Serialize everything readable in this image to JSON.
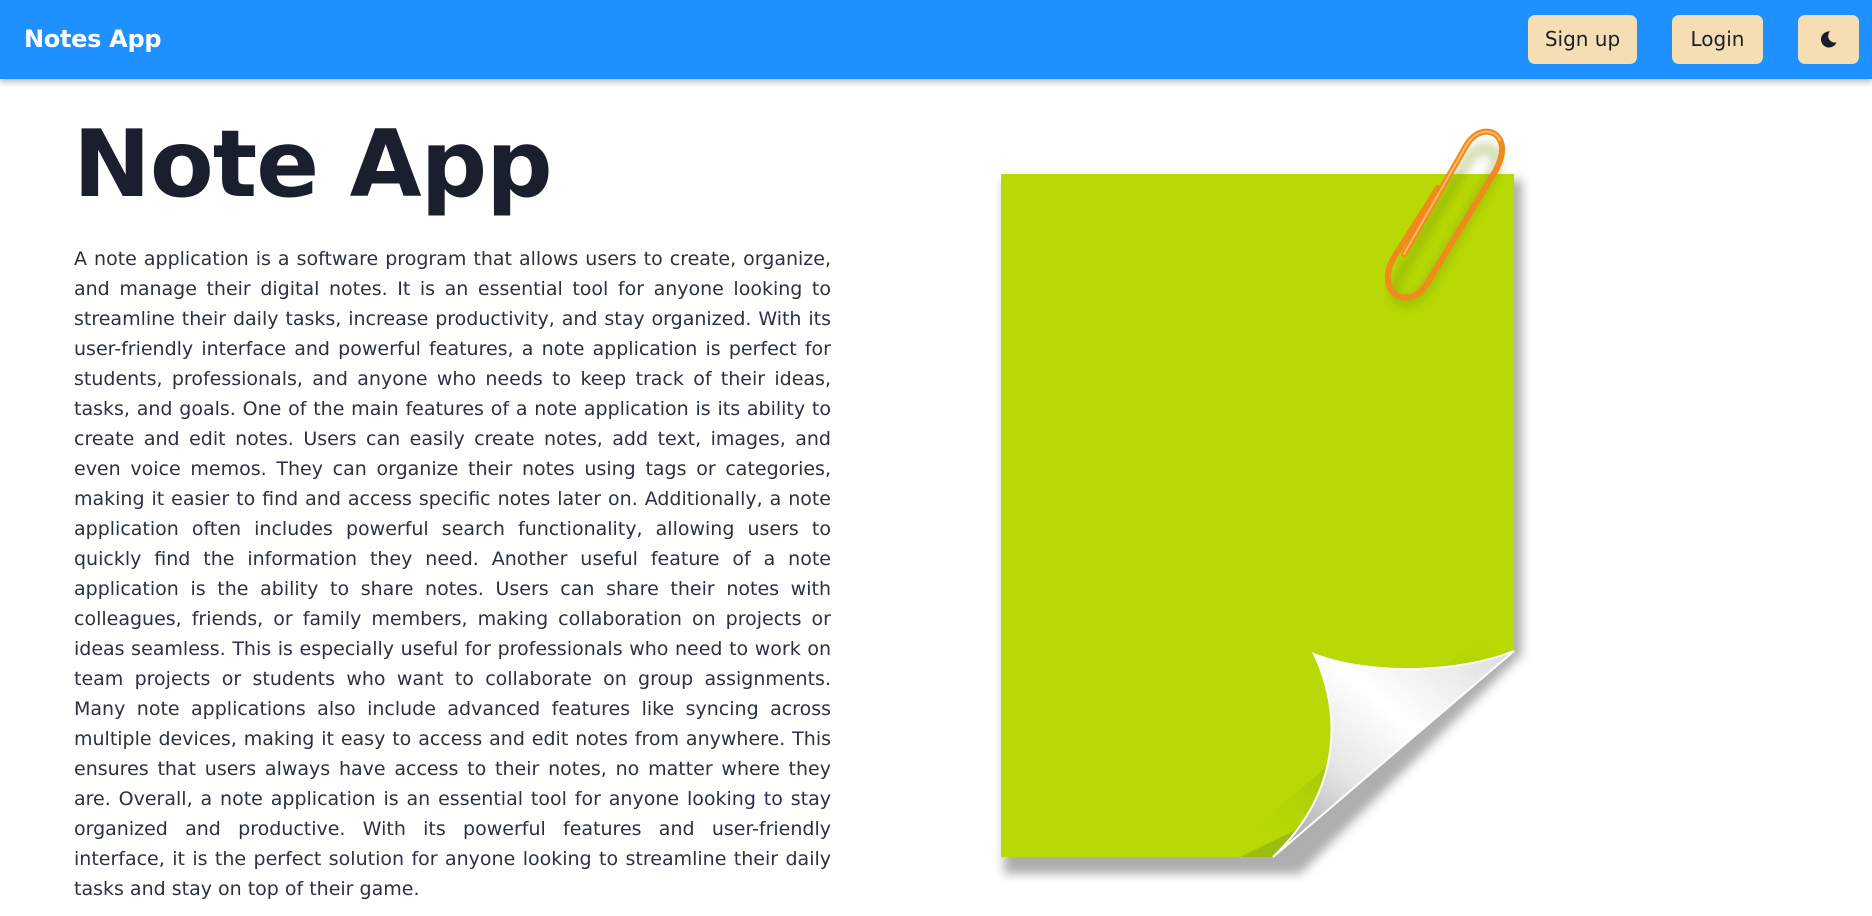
{
  "navbar": {
    "brand": "Notes App",
    "signup_label": "Sign up",
    "login_label": "Login",
    "theme_toggle_icon": "moon-icon",
    "background_color": "#1e90ff",
    "button_color": "#f5deb3"
  },
  "hero": {
    "title": "Note App",
    "description": "A note application is a software program that allows users to create, organize, and manage their digital notes. It is an essential tool for anyone looking to streamline their daily tasks, increase productivity, and stay organized. With its user-friendly interface and powerful features, a note application is perfect for students, professionals, and anyone who needs to keep track of their ideas, tasks, and goals. One of the main features of a note application is its ability to create and edit notes. Users can easily create notes, add text, images, and even voice memos. They can organize their notes using tags or categories, making it easier to find and access specific notes later on. Additionally, a note application often includes powerful search functionality, allowing users to quickly find the information they need. Another useful feature of a note application is the ability to share notes. Users can share their notes with colleagues, friends, or family members, making collaboration on projects or ideas seamless. This is especially useful for professionals who need to work on team projects or students who want to collaborate on group assignments. Many note applications also include advanced features like syncing across multiple devices, making it easy to access and edit notes from anywhere. This ensures that users always have access to their notes, no matter where they are. Overall, a note application is an essential tool for anyone looking to stay organized and productive. With its powerful features and user-friendly interface, it is the perfect solution for anyone looking to streamline their daily tasks and stay on top of their game."
  },
  "illustration": {
    "icon": "sticky-note-paperclip-illustration",
    "note_color": "#b8d905",
    "clip_color": "#f08a1c"
  }
}
